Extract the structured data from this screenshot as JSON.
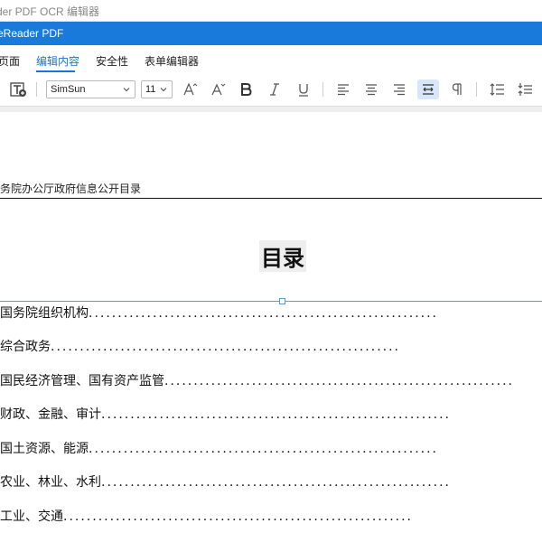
{
  "window": {
    "title": "der PDF OCR 编辑器"
  },
  "app": {
    "name": "eReader PDF"
  },
  "menu": {
    "items": [
      {
        "label": "页面",
        "active": false
      },
      {
        "label": "编辑内容",
        "active": true
      },
      {
        "label": "安全性",
        "active": false
      },
      {
        "label": "表单编辑器",
        "active": false
      }
    ]
  },
  "toolbar": {
    "font_family": "SimSun",
    "font_size": "11",
    "accent_color": "#1a73d9",
    "icons": [
      "add-text-icon",
      "increase-font-icon",
      "decrease-font-icon",
      "bold-icon",
      "italic-icon",
      "underline-icon",
      "align-left-icon",
      "align-center-icon",
      "align-right-icon",
      "justify-icon",
      "paragraph-icon",
      "line-spacing-icon",
      "paragraph-spacing-icon"
    ]
  },
  "document": {
    "header": "务院办公厅政府信息公开目录",
    "title": "目录",
    "toc": [
      {
        "label": "国务院组织机构"
      },
      {
        "label": "综合政务"
      },
      {
        "label": "国民经济管理、国有资产监管"
      },
      {
        "label": "财政、金融、审计"
      },
      {
        "label": "国土资源、能源"
      },
      {
        "label": "农业、林业、水利"
      },
      {
        "label": "工业、交通"
      }
    ],
    "leader": "............................................................"
  }
}
